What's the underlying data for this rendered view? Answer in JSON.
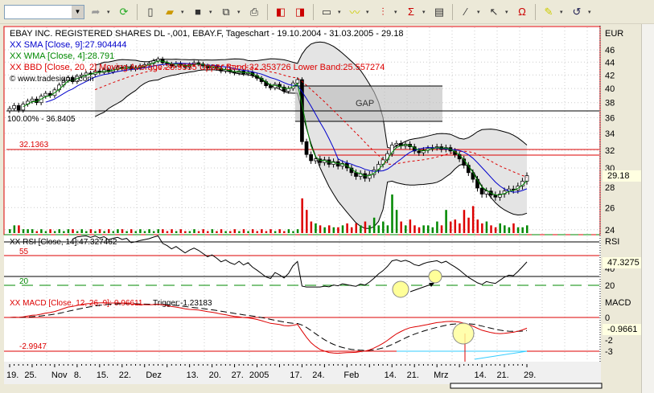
{
  "toolbar": {
    "symbol_value": ""
  },
  "chart": {
    "title": "EBAY INC. REGISTERED SHARES DL -,001, EBAY.F, Tageschart - 19.10.2004 - 31.03.2005 - 29.18",
    "sma_label": "XX SMA [Close, 9]:27.904444",
    "wma_label": "XX WMA [Close, 4]:28.791",
    "bbd_label": "XX BBD [Close, 20, 2] Moving Average:28.9555 Upper Band:32.353726 Lower Band:25.557274",
    "copyright": "© www.tradesignal.com",
    "fib_label": "100.00% - 36.8405",
    "level_label": "32.1363",
    "gap_label": "GAP",
    "currency": "EUR",
    "last_price": "29.18",
    "rsi_label": "XX RSI [Close, 14]:47.327462",
    "rsi_axis": "RSI",
    "rsi_55": "55",
    "rsi_20": "20",
    "rsi_last": "47.3275",
    "macd_label": "XX MACD [Close, 12, 26, 9]:-0.96611",
    "macd_trigger": "Trigger:-1.23183",
    "macd_axis": "MACD",
    "macd_level": "-2.9947",
    "macd_last": "-0.9661"
  },
  "chart_data": {
    "type": "candlestick",
    "title": "EBAY INC. REGISTERED SHARES DL -,001, EBAY.F, Tageschart",
    "ylabel": "EUR",
    "ylim": [
      24,
      46
    ],
    "price_ticks": [
      46,
      44,
      42,
      40,
      38,
      36,
      34,
      32,
      30,
      28,
      26,
      24
    ],
    "rsi_ticks": [
      40,
      20
    ],
    "macd_ticks": [
      0,
      -2,
      -3
    ],
    "x_labels": [
      "19.",
      "25.",
      "Nov",
      "8.",
      "15.",
      "22.",
      "Dez",
      "13.",
      "20.",
      "27.",
      "2005",
      "17.",
      "24.",
      "Feb",
      "14.",
      "21.",
      "Mrz",
      "14.",
      "21.",
      "29."
    ],
    "x_label_days": [
      0,
      4,
      10,
      15,
      20,
      25,
      31,
      40,
      45,
      50,
      54,
      63,
      68,
      75,
      84,
      89,
      95,
      104,
      109,
      115
    ],
    "close": [
      37.2,
      37.6,
      37.0,
      37.8,
      38.2,
      38.5,
      38.0,
      38.9,
      39.3,
      39.0,
      39.8,
      40.5,
      41.2,
      41.6,
      41.0,
      41.8,
      42.0,
      42.3,
      42.1,
      42.6,
      42.4,
      42.8,
      42.5,
      42.9,
      43.2,
      43.0,
      43.3,
      42.9,
      43.1,
      43.4,
      43.6,
      43.8,
      44.2,
      44.5,
      43.9,
      43.7,
      43.4,
      43.8,
      43.5,
      43.2,
      43.6,
      43.9,
      43.7,
      43.4,
      43.1,
      43.3,
      43.0,
      42.6,
      42.8,
      42.5,
      42.3,
      42.6,
      42.2,
      42.4,
      41.9,
      41.5,
      41.0,
      40.4,
      40.1,
      40.6,
      40.2,
      39.6,
      40.0,
      40.8,
      41.3,
      33.0,
      31.5,
      30.8,
      31.0,
      30.6,
      30.9,
      30.4,
      30.7,
      30.2,
      30.5,
      30.0,
      29.5,
      29.1,
      29.4,
      28.9,
      29.3,
      29.8,
      30.4,
      30.9,
      31.6,
      32.6,
      32.8,
      32.5,
      32.7,
      32.4,
      31.9,
      31.7,
      32.0,
      32.2,
      32.3,
      32.4,
      32.1,
      32.3,
      31.9,
      31.5,
      31.0,
      30.3,
      29.5,
      28.8,
      27.9,
      27.3,
      27.6,
      27.2,
      27.0,
      27.3,
      27.6,
      27.8,
      27.7,
      28.1,
      28.6,
      29.18
    ],
    "volume": [
      1,
      2,
      2,
      1,
      1,
      1,
      0.5,
      1,
      0.5,
      1,
      0.5,
      1,
      0.5,
      1,
      1,
      0.5,
      1,
      0.5,
      1,
      0.5,
      1,
      0.5,
      1,
      0.5,
      1,
      1,
      0.5,
      1,
      0.5,
      1,
      0.5,
      1,
      0.5,
      1,
      1,
      0.5,
      1,
      0.5,
      1,
      0.5,
      0.5,
      1,
      0.5,
      1,
      0.5,
      1,
      0.5,
      1,
      0.5,
      0.5,
      1,
      0.5,
      1,
      0.5,
      1,
      0.5,
      1,
      0.5,
      1,
      0.5,
      1,
      0.5,
      1,
      0.5,
      1,
      9,
      6,
      3,
      2.5,
      2,
      1.5,
      2,
      1.5,
      1.5,
      2,
      2.5,
      1.5,
      2.5,
      2,
      3,
      2,
      4,
      2,
      3,
      2,
      10,
      6,
      3,
      2,
      3.5,
      2,
      1.5,
      2,
      2,
      1.5,
      3,
      2,
      6,
      3,
      3.5,
      2.5,
      6,
      4,
      7,
      3.5,
      2.5,
      3,
      2,
      1.5,
      2.5,
      2,
      1.5,
      2.5,
      1.5,
      1.5,
      2
    ],
    "horizontal_levels": [
      36.8405,
      32.1363,
      31.3
    ],
    "gap_zone": [
      35.7,
      40.2
    ],
    "macd_level": -2.9947,
    "rsi_levels": [
      55,
      20
    ]
  }
}
